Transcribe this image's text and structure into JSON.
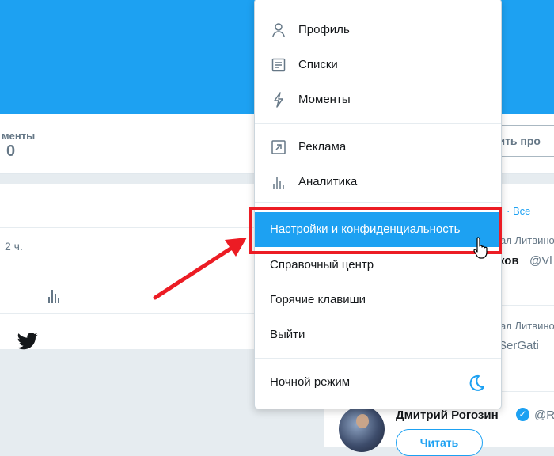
{
  "profile": {
    "stat_label": "менты",
    "stat_value": "0",
    "edit_button": "нить про"
  },
  "tweet": {
    "time": "2 ч."
  },
  "menu": {
    "items": [
      {
        "label": "Профиль",
        "icon": "person-icon"
      },
      {
        "label": "Списки",
        "icon": "list-icon"
      },
      {
        "label": "Моменты",
        "icon": "lightning-icon"
      },
      {
        "label": "Реклама",
        "icon": "arrow-up-right-icon"
      },
      {
        "label": "Аналитика",
        "icon": "analytics-icon"
      },
      {
        "label": "Настройки и конфиденциальность",
        "icon": null
      },
      {
        "label": "Справочный центр",
        "icon": null
      },
      {
        "label": "Горячие клавиши",
        "icon": null
      },
      {
        "label": "Выйти",
        "icon": null
      },
      {
        "label": "Ночной режим",
        "icon": "moon-icon"
      }
    ]
  },
  "right_column": {
    "view_all": "· Все",
    "follow_ctx_1": "ал Литвино",
    "name_1": "ков",
    "handle_1": "@Vl",
    "follow_ctx_2": "ал Литвино",
    "handle_2": "SerGati",
    "name_3": "Дмитрий Рогозин",
    "handle_3": "@R",
    "follow_button": "Читать"
  },
  "colors": {
    "brand": "#1da1f2",
    "annotation": "#ec1c24"
  }
}
